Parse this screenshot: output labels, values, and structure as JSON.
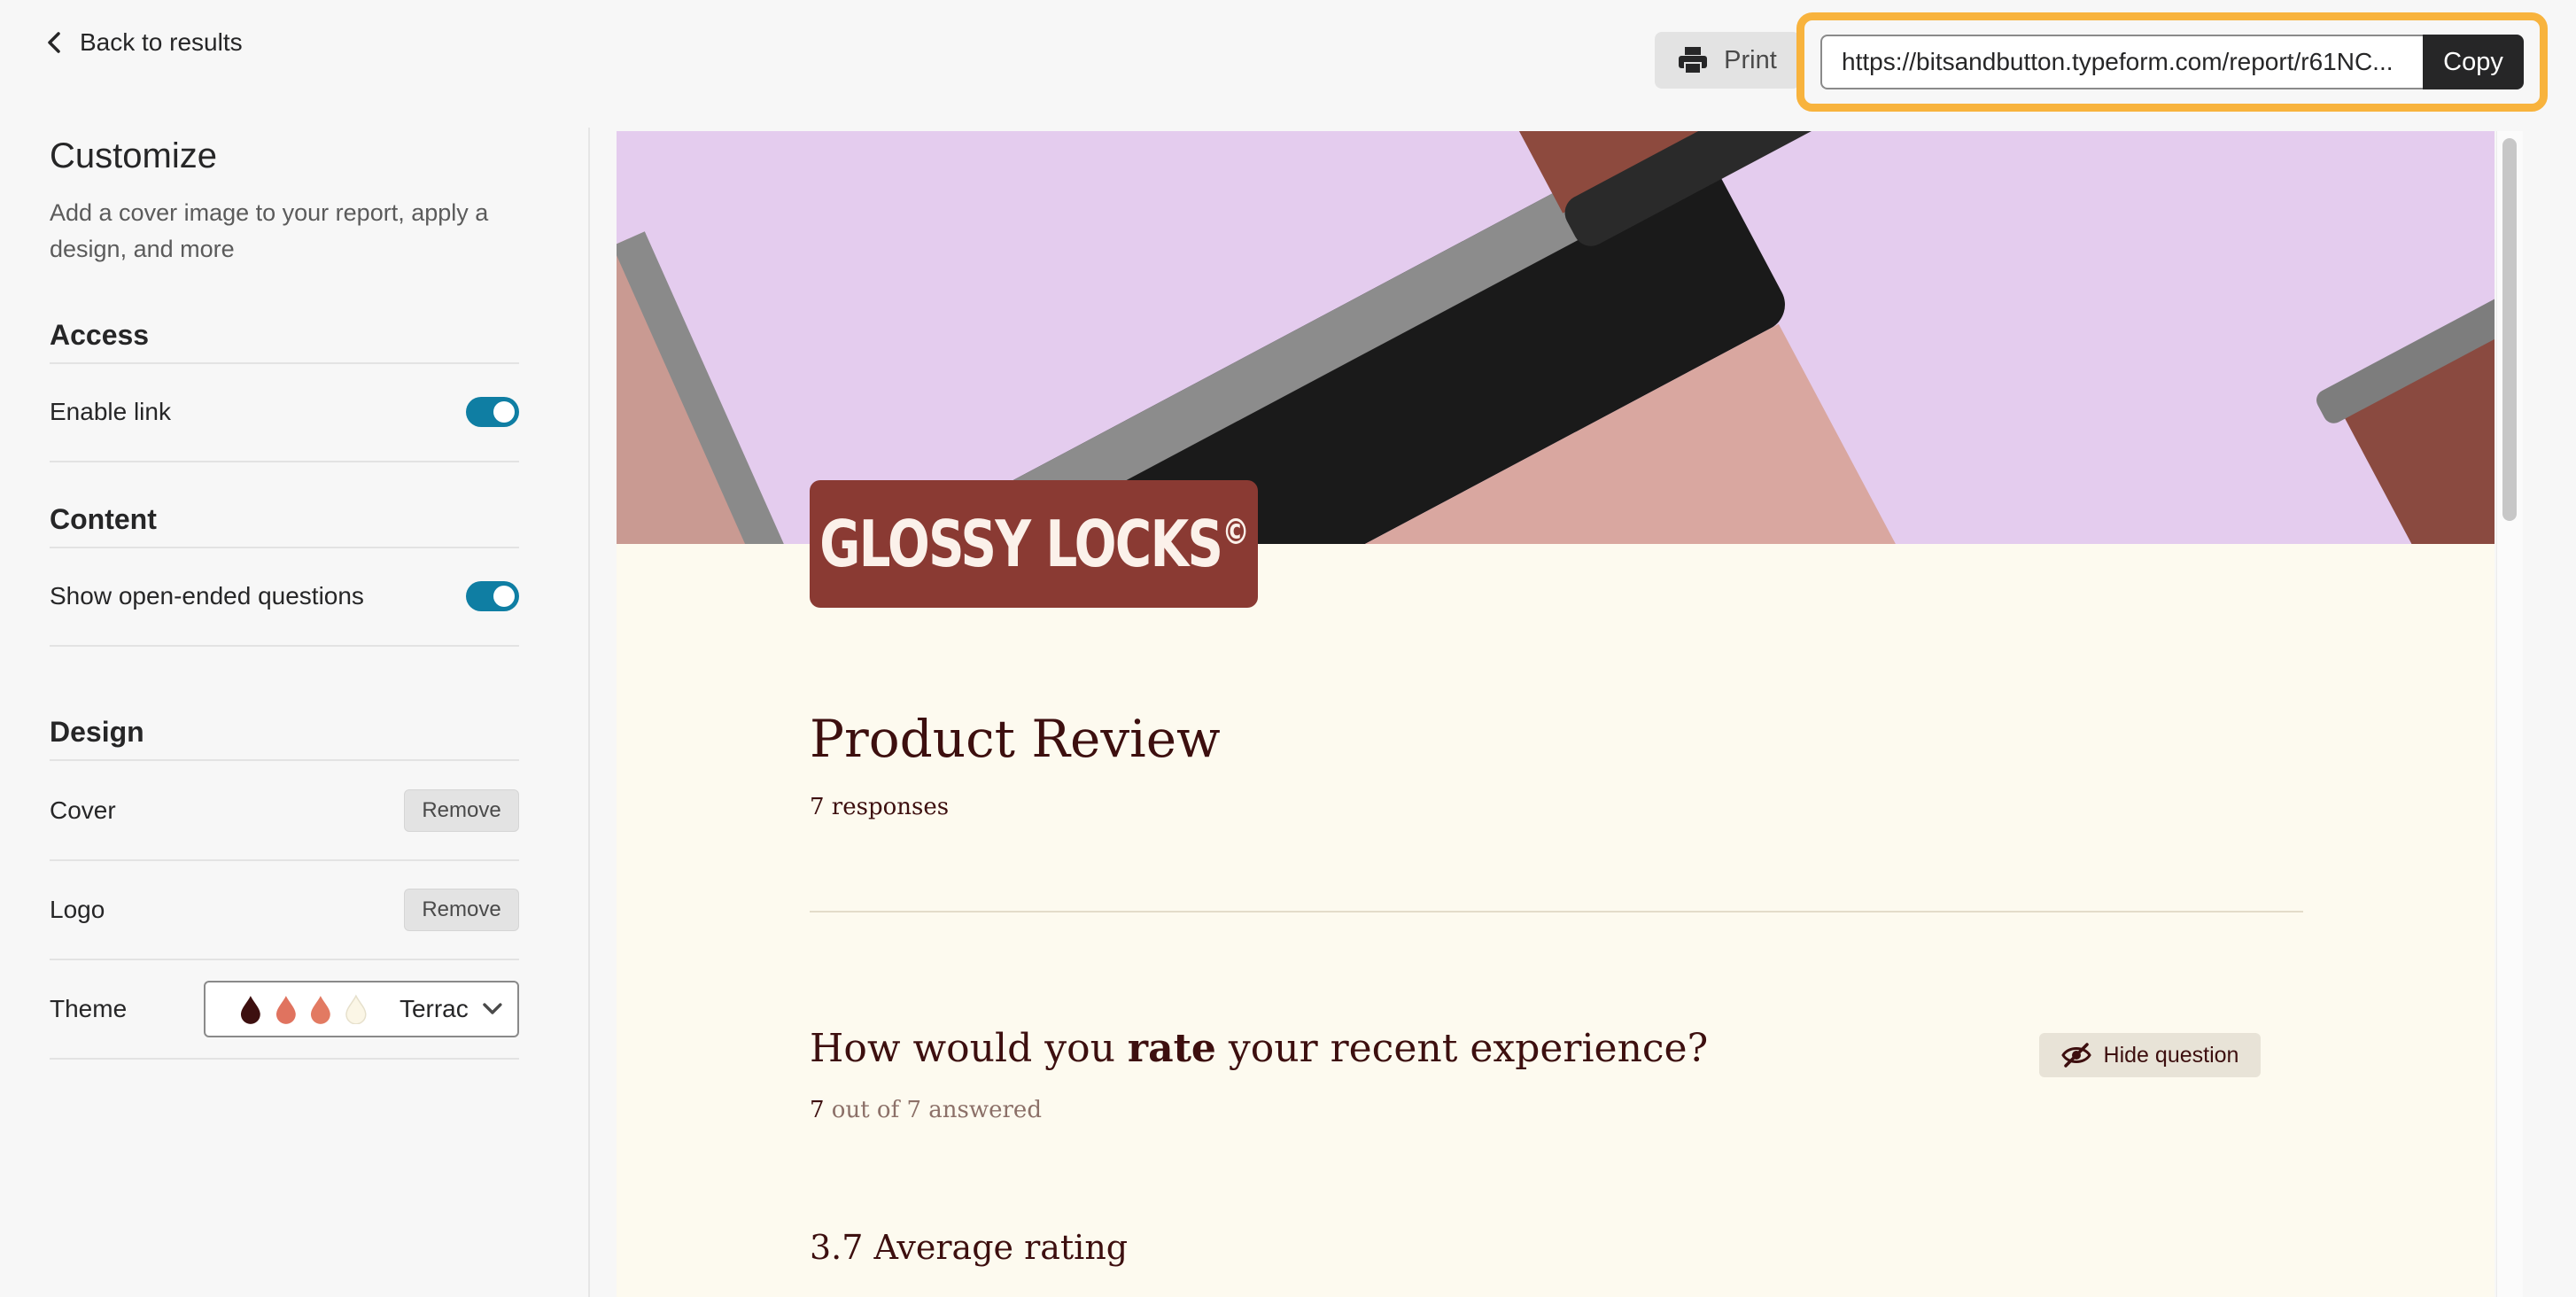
{
  "topbar": {
    "back_label": "Back to results",
    "print_label": "Print",
    "share_url": "https://bitsandbutton.typeform.com/report/r61NC...",
    "copy_label": "Copy"
  },
  "sidebar": {
    "title": "Customize",
    "description": "Add a cover image to your report, apply a design, and more",
    "access": {
      "heading": "Access",
      "enable_link_label": "Enable link",
      "enable_link_on": true
    },
    "content": {
      "heading": "Content",
      "open_ended_label": "Show open-ended questions",
      "open_ended_on": true
    },
    "design": {
      "heading": "Design",
      "cover_label": "Cover",
      "cover_remove": "Remove",
      "logo_label": "Logo",
      "logo_remove": "Remove",
      "theme_label": "Theme",
      "theme_value": "Terrac",
      "theme_swatches": [
        "#3d0f0f",
        "#e0735f",
        "#e27a62",
        "#fbf6e6"
      ]
    }
  },
  "report": {
    "logo_text": "GLOSSY LOCKS",
    "logo_mark": "©",
    "title": "Product Review",
    "responses": "7 responses",
    "question_pre": "How would you ",
    "question_bold": "rate",
    "question_post": " your recent experience?",
    "answered_count": "7",
    "answered_rest": " out of 7 answered",
    "hide_label": "Hide question",
    "average": "3.7 Average rating"
  },
  "colors": {
    "accent_toggle": "#0f7ea3",
    "highlight": "#f8b33d",
    "report_text": "#3d0f0f",
    "report_bg": "#fdfaef",
    "cover_bg": "#e4ccee",
    "logo_bg": "#8a3a33"
  }
}
